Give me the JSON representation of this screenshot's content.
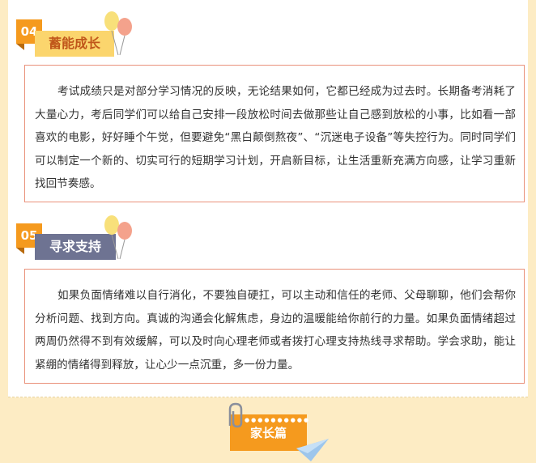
{
  "sections": [
    {
      "number": "04",
      "title": "蓄能成长",
      "body": "考试成绩只是对部分学习情况的反映，无论结果如何，它都已经成为过去时。长期备考消耗了大量心力，考后同学们可以给自己安排一段放松时间去做那些让自己感到放松的小事，比如看一部喜欢的电影，好好睡个午觉，但要避免“黑白颠倒熬夜”、“沉迷电子设备”等失控行为。同时同学们可以制定一个新的、切实可行的短期学习计划，开启新目标，让生活重新充满方向感，让学习重新找回节奏感。"
    },
    {
      "number": "05",
      "title": "寻求支持",
      "body": "如果负面情绪难以自行消化，不要独自硬扛，可以主动和信任的老师、父母聊聊，他们会帮你分析问题、找到方向。真诚的沟通会化解焦虑，身边的温暖能给你前行的力量。如果负面情绪超过两周仍然得不到有效缓解，可以及时向心理老师或者拨打心理支持热线寻求帮助。学会求助，能让紧绷的情绪得到释放，让心少一点沉重，多一份力量。"
    }
  ],
  "footer": {
    "label": "家长篇"
  },
  "colors": {
    "accent": "#f59a1e",
    "tag_yellow": "#fbd56d",
    "tag_slate": "#6e7392",
    "box_border": "#e9917a",
    "page_bg": "#fdecc4"
  }
}
